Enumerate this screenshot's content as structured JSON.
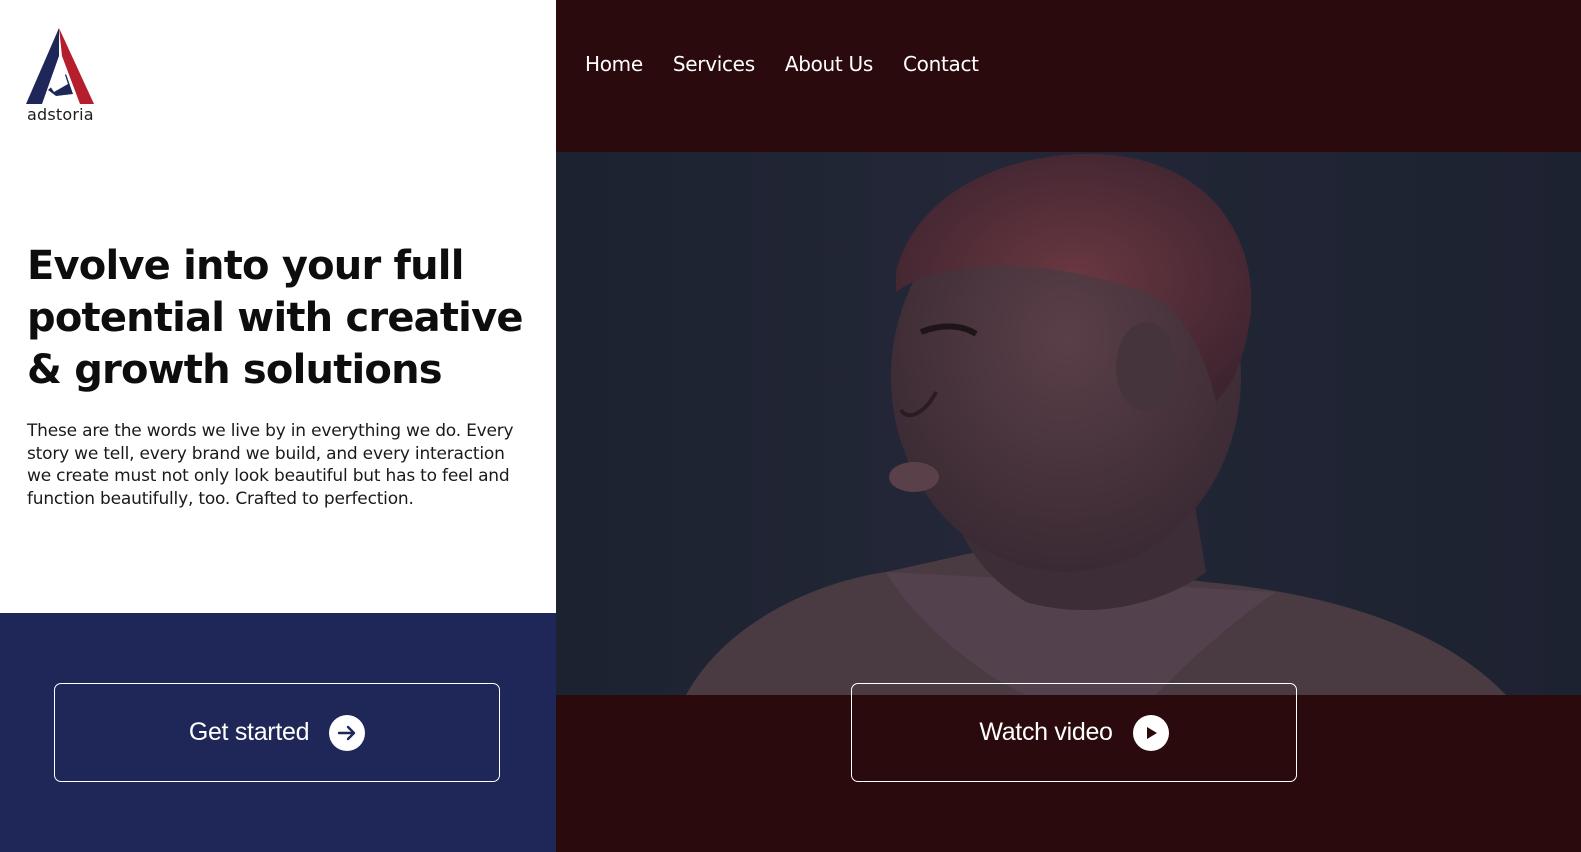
{
  "brand": {
    "name": "adstoria",
    "colors": {
      "navy": "#1e2757",
      "red": "#b51f2d",
      "dark_bg": "#2a0a0c"
    }
  },
  "nav": {
    "items": [
      "Home",
      "Services",
      "About Us",
      "Contact"
    ]
  },
  "hero": {
    "headline": "Evolve into your full potential with creative & growth solutions",
    "body": "These are the words we live by in everything we do. Every story we tell, every brand we build, and every interaction we create must not only look beautiful but has to feel and function beautifully, too. Crafted to perfection."
  },
  "buttons": {
    "get_started": {
      "label": "Get started",
      "icon": "arrow-right-icon"
    },
    "watch_video": {
      "label": "Watch video",
      "icon": "play-icon"
    }
  }
}
